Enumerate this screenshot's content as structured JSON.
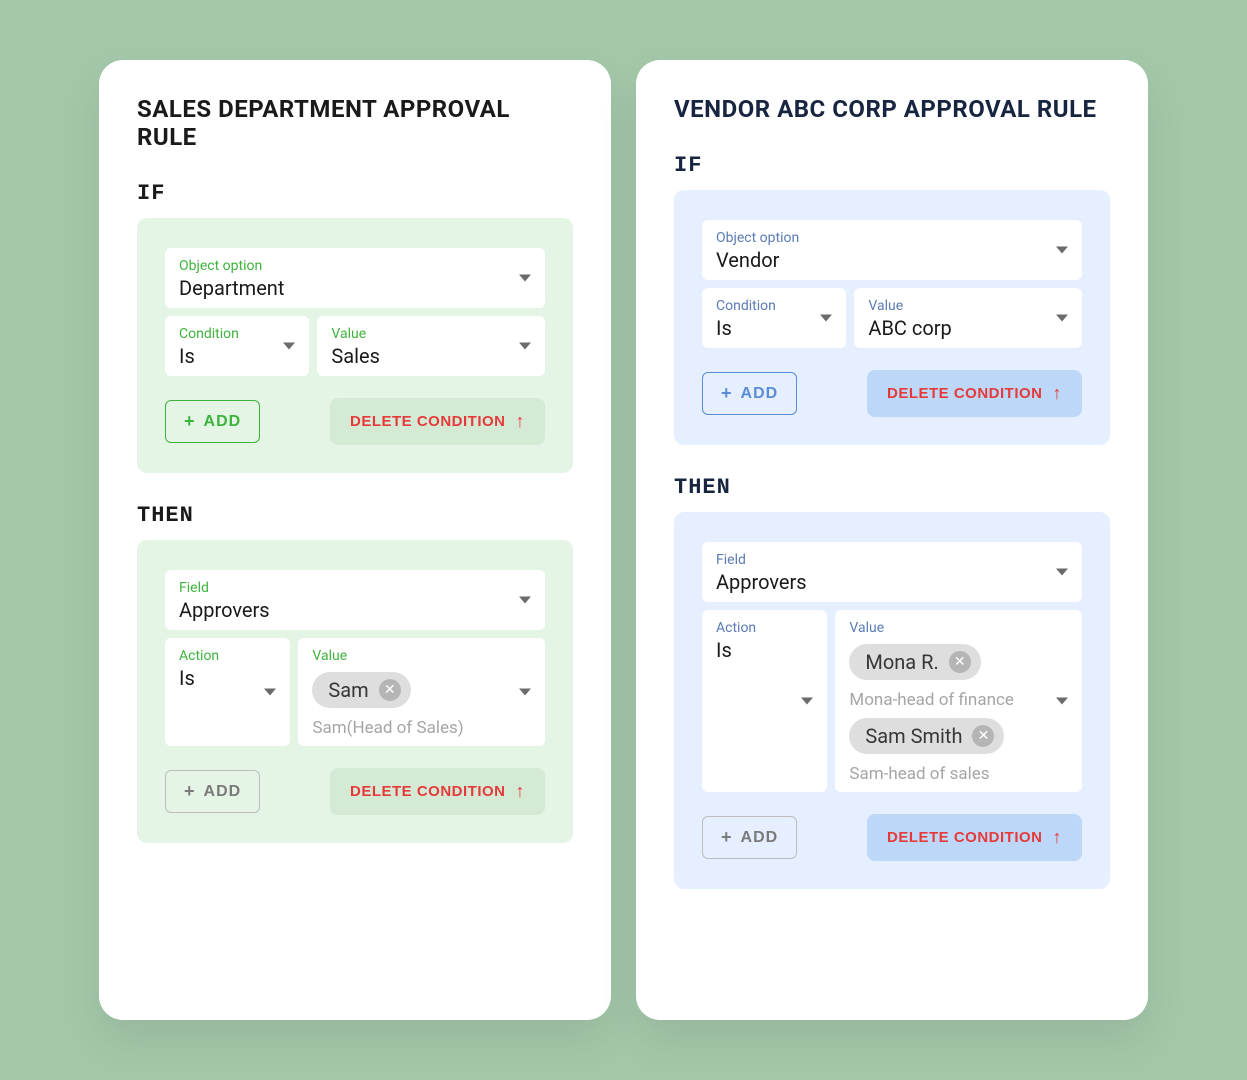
{
  "labels": {
    "if": "IF",
    "then": "THEN",
    "object_option": "Object option",
    "condition": "Condition",
    "value": "Value",
    "field": "Field",
    "action": "Action",
    "add": "ADD",
    "delete_condition": "DELETE CONDITION"
  },
  "left": {
    "title": "SALES DEPARTMENT APPROVAL RULE",
    "if": {
      "object_option": "Department",
      "condition": "Is",
      "value": "Sales"
    },
    "then": {
      "field": "Approvers",
      "action": "Is",
      "chips": [
        {
          "name": "Sam",
          "caption": "Sam(Head of Sales)"
        }
      ]
    }
  },
  "right": {
    "title": "VENDOR ABC CORP APPROVAL RULE",
    "if": {
      "object_option": "Vendor",
      "condition": "Is",
      "value": "ABC corp"
    },
    "then": {
      "field": "Approvers",
      "action": "Is",
      "chips": [
        {
          "name": "Mona R.",
          "caption": "Mona-head of finance"
        },
        {
          "name": "Sam Smith",
          "caption": "Sam-head of sales"
        }
      ]
    }
  }
}
